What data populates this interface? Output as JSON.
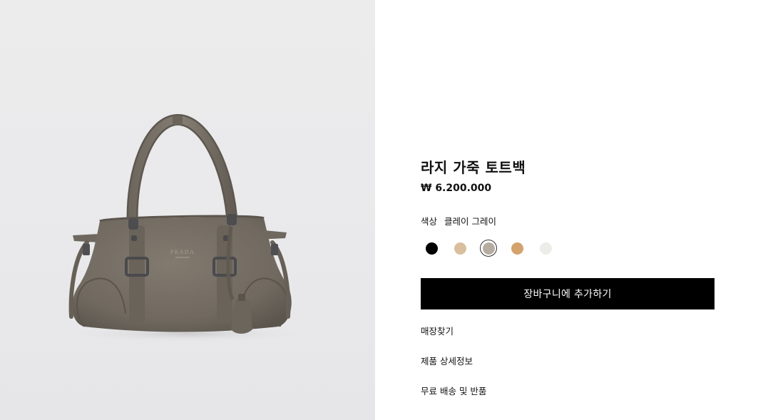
{
  "product": {
    "title": "라지 가죽 토트백",
    "price": "₩ 6.200.000",
    "brand_mark": "PRADA",
    "image": {
      "name": "product-image",
      "colors": {
        "background": "#ebebec",
        "leather": "#726b61",
        "leather_shadow": "#5e584f",
        "hardware": "#4d4d4f"
      }
    }
  },
  "color_selector": {
    "label": "색상",
    "selected_name": "클레이 그레이",
    "swatches": [
      {
        "name": "black",
        "hex": "#000000",
        "selected": false
      },
      {
        "name": "beige",
        "hex": "#d9bf9e",
        "selected": false
      },
      {
        "name": "clay-gray",
        "hex": "#b7aca2",
        "selected": true
      },
      {
        "name": "caramel",
        "hex": "#d3a26d",
        "selected": false
      },
      {
        "name": "white",
        "hex": "#ecece9",
        "selected": false
      }
    ]
  },
  "actions": {
    "add_to_cart": "장바구니에 추가하기"
  },
  "links": {
    "find_store": "매장찾기",
    "product_details": "제품 상세정보",
    "shipping_returns": "무료 배송 및 반품"
  }
}
